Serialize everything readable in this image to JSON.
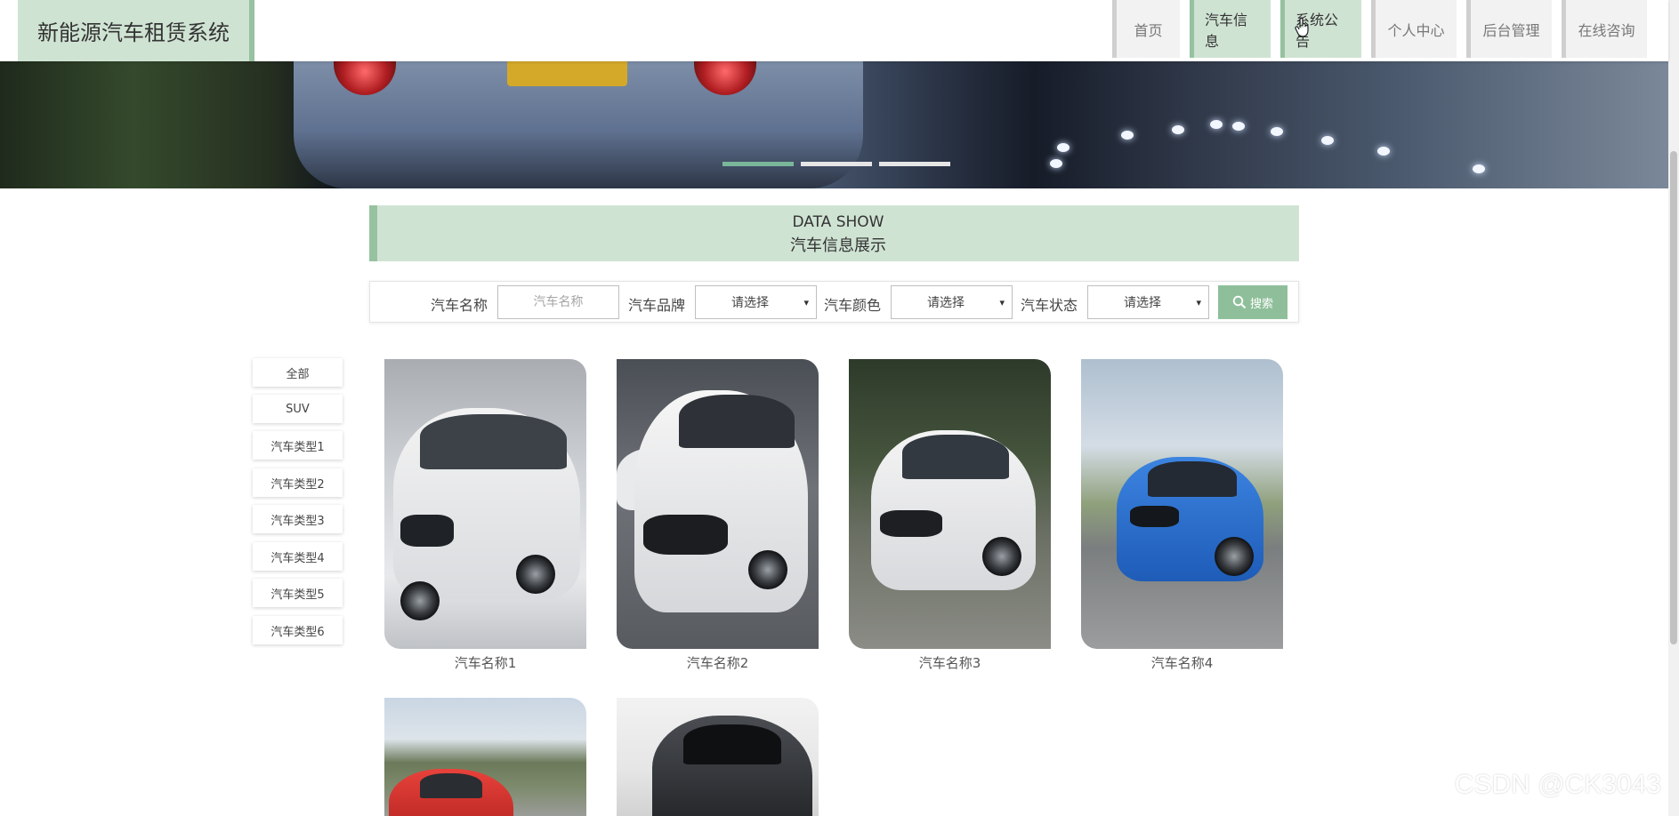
{
  "app": {
    "title": "新能源汽车租赁系统"
  },
  "nav": {
    "items": [
      {
        "label": "首页",
        "active": false
      },
      {
        "label": "汽车信息",
        "active": true
      },
      {
        "label": "系统公告",
        "active": true
      },
      {
        "label": "个人中心",
        "active": false
      },
      {
        "label": "后台管理",
        "active": false
      },
      {
        "label": "在线咨询",
        "active": false
      }
    ]
  },
  "carousel": {
    "dots": 3,
    "active_index": 0
  },
  "section": {
    "title_en": "DATA SHOW",
    "title_cn": "汽车信息展示"
  },
  "search": {
    "name_label": "汽车名称",
    "name_placeholder": "汽车名称",
    "brand_label": "汽车品牌",
    "brand_value": "请选择",
    "color_label": "汽车颜色",
    "color_value": "请选择",
    "status_label": "汽车状态",
    "status_value": "请选择",
    "button_label": "搜索"
  },
  "categories": [
    "全部",
    "SUV",
    "汽车类型1",
    "汽车类型2",
    "汽车类型3",
    "汽车类型4",
    "汽车类型5",
    "汽车类型6"
  ],
  "cars": [
    {
      "name": "汽车名称1",
      "color": "white"
    },
    {
      "name": "汽车名称2",
      "color": "white"
    },
    {
      "name": "汽车名称3",
      "color": "white"
    },
    {
      "name": "汽车名称4",
      "color": "blue"
    },
    {
      "name": "",
      "color": "red"
    },
    {
      "name": "",
      "color": "black"
    }
  ],
  "watermark": "CSDN @CK3043",
  "colors": {
    "accent": "#97c2a0",
    "accent_light": "#cfe3d3",
    "button": "#8fbf9a"
  }
}
